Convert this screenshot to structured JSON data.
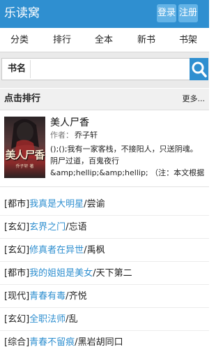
{
  "header": {
    "logo": "乐读窝",
    "login": "登录",
    "register": "注册"
  },
  "nav": [
    "分类",
    "排行",
    "全本",
    "新书",
    "书架"
  ],
  "search": {
    "label": "书名",
    "value": ""
  },
  "section": {
    "title": "点击排行",
    "more": "更多..."
  },
  "featured": {
    "cover_title": "美人尸香",
    "cover_subtitle": "乔子轩 著",
    "title": "美人尸香",
    "author_label": "作者：",
    "author": "乔子轩",
    "description": "();();我有一家客栈，不接阳人，只送阴魂。 阴尸过道，百鬼夜行&amp;hellip;&amp;hellip; （注：本文根据部分真实事件改编，如有雷同，请"
  },
  "rank_list": [
    {
      "category": "[都市]",
      "title": "我真是大明星",
      "sep": "/",
      "author": "尝谕"
    },
    {
      "category": "[玄幻]",
      "title": "玄界之门",
      "sep": "/",
      "author": "忘语"
    },
    {
      "category": "[玄幻]",
      "title": "修真者在异世",
      "sep": "/",
      "author": "禹枫"
    },
    {
      "category": "[都市]",
      "title": "我的姐姐是美女",
      "sep": "/",
      "author": "天下第二"
    },
    {
      "category": "[现代]",
      "title": "青春有毒",
      "sep": "/",
      "author": "齐悦"
    },
    {
      "category": "[玄幻]",
      "title": "全职法师",
      "sep": "/",
      "author": "乱"
    },
    {
      "category": "[综合]",
      "title": "青春不留痕",
      "sep": "/",
      "author": "黑岩胡同口"
    }
  ],
  "colors": {
    "accent": "#2f8fd0",
    "header_button": "#64b3e6",
    "link": "#2f8fd0"
  },
  "icons": {
    "search_button": "search-icon"
  }
}
